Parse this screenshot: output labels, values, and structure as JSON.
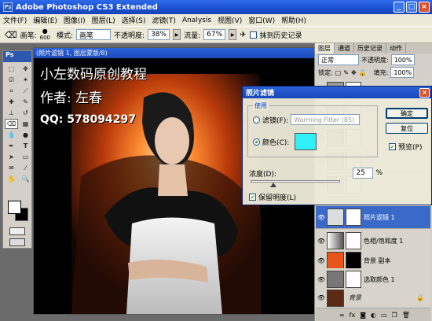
{
  "app": {
    "title": "Adobe Photoshop CS3 Extended"
  },
  "menu": [
    "文件(F)",
    "编辑(E)",
    "图像(I)",
    "图层(L)",
    "选择(S)",
    "滤镜(T)",
    "Analysis",
    "视图(V)",
    "窗口(W)",
    "帮助(H)"
  ],
  "options": {
    "brush_label": "画笔:",
    "brush_size": "600",
    "mode_label": "模式:",
    "mode_value": "画笔",
    "opacity_label": "不透明度:",
    "opacity_value": "38%",
    "flow_label": "流量:",
    "flow_value": "67%",
    "erase_history_label": "抹到历史记录"
  },
  "toolbox": {
    "header": "Ps"
  },
  "document": {
    "title": "(照片滤镜 1, 图层蒙版/8)",
    "watermark_line1": "小左数码原创教程",
    "watermark_line2": "作者: 左春",
    "watermark_line3": "QQ: 578094297"
  },
  "layers_panel": {
    "tabs": [
      "图层",
      "通道",
      "历史记录",
      "动作"
    ],
    "blend_mode": "正常",
    "opacity_label": "不透明度:",
    "opacity_value": "100%",
    "lock_label": "锁定:",
    "fill_label": "填充:",
    "fill_value": "100%",
    "layers": [
      {
        "name": "照片滤镜 1",
        "selected": true
      },
      {
        "name": "色相/饱和度 1",
        "selected": false
      },
      {
        "name": "背景 副本",
        "selected": false
      },
      {
        "name": "选取颜色 1",
        "selected": false
      },
      {
        "name": "背景",
        "selected": false
      }
    ]
  },
  "dialog": {
    "title": "照片滤镜",
    "use_group": "使用",
    "filter_label": "滤镜(F):",
    "filter_value": "Warming Filter (85)",
    "color_label": "颜色(C):",
    "color_hex": "#2ef0f6",
    "density_label": "浓度(D):",
    "density_value": "25",
    "density_unit": "%",
    "density_level": 0.25,
    "preserve_label": "保留明度(L)",
    "ok_label": "确定",
    "reset_label": "复位",
    "preview_label": "预览(P)"
  }
}
